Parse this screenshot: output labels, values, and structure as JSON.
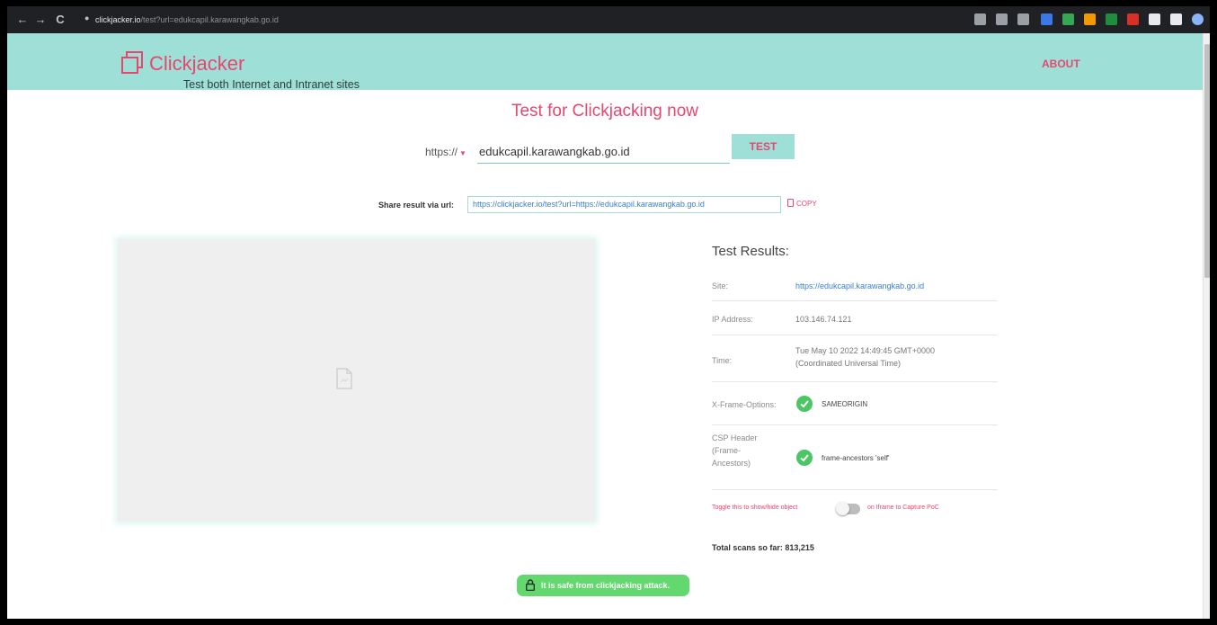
{
  "browser": {
    "url_host": "clickjacker.io",
    "url_path": "/test?url=edukcapil.karawangkab.go.id",
    "nav": [
      "back-icon",
      "forward-icon",
      "reload-icon"
    ],
    "extensions": [
      {
        "name": "translate-icon",
        "color": "#9aa0a6"
      },
      {
        "name": "share-icon",
        "color": "#9aa0a6"
      },
      {
        "name": "star-icon",
        "color": "#9aa0a6"
      },
      {
        "name": "ext-blue-icon",
        "color": "#3b78e7"
      },
      {
        "name": "ext-camera-icon",
        "color": "#34a853"
      },
      {
        "name": "ext-orange-icon",
        "color": "#f29900"
      },
      {
        "name": "ext-shield-icon",
        "color": "#1e8e3e"
      },
      {
        "name": "ext-red-icon",
        "color": "#d93025"
      },
      {
        "name": "extensions-icon",
        "color": "#e8eaed"
      },
      {
        "name": "window-icon",
        "color": "#e8eaed"
      },
      {
        "name": "profile-icon",
        "color": "#8ab4f8"
      }
    ]
  },
  "header": {
    "brand": "Clickjacker",
    "tagline": "Test both Internet and Intranet sites",
    "about": "ABOUT"
  },
  "main": {
    "headline": "Test for Clickjacking now",
    "protocol": "https://",
    "url_value": "edukcapil.karawangkab.go.id",
    "test_button": "TEST",
    "share_label": "Share result via url:",
    "share_url": "https://clickjacker.io/test?url=https://edukcapil.karawangkab.go.id",
    "copy": "COPY"
  },
  "results": {
    "title": "Test Results:",
    "site_label": "Site:",
    "site_value": "https://edukcapil.karawangkab.go.id",
    "ip_label": "IP Address:",
    "ip_value": "103.146.74.121",
    "time_label": "Time:",
    "time_value_1": "Tue May 10 2022 14:49:45 GMT+0000",
    "time_value_2": "(Coordinated Universal Time)",
    "xfo_label": "X-Frame-Options:",
    "xfo_value": "SAMEORIGIN",
    "csp_label_1": "CSP Header",
    "csp_label_2": "(Frame-",
    "csp_label_3": "Ancestors)",
    "csp_value": "frame-ancestors 'self'",
    "toggle_left": "Toggle this to show/hide object",
    "toggle_right": "on Iframe to Capture PoC",
    "total_scans": "Total scans so far: 813,215"
  },
  "safe_badge": "It is safe from clickjacking attack.",
  "colors": {
    "accent": "#e8476d",
    "header_bg": "#9ee0d8",
    "success": "#63d86e",
    "link": "#3c7ecb"
  }
}
